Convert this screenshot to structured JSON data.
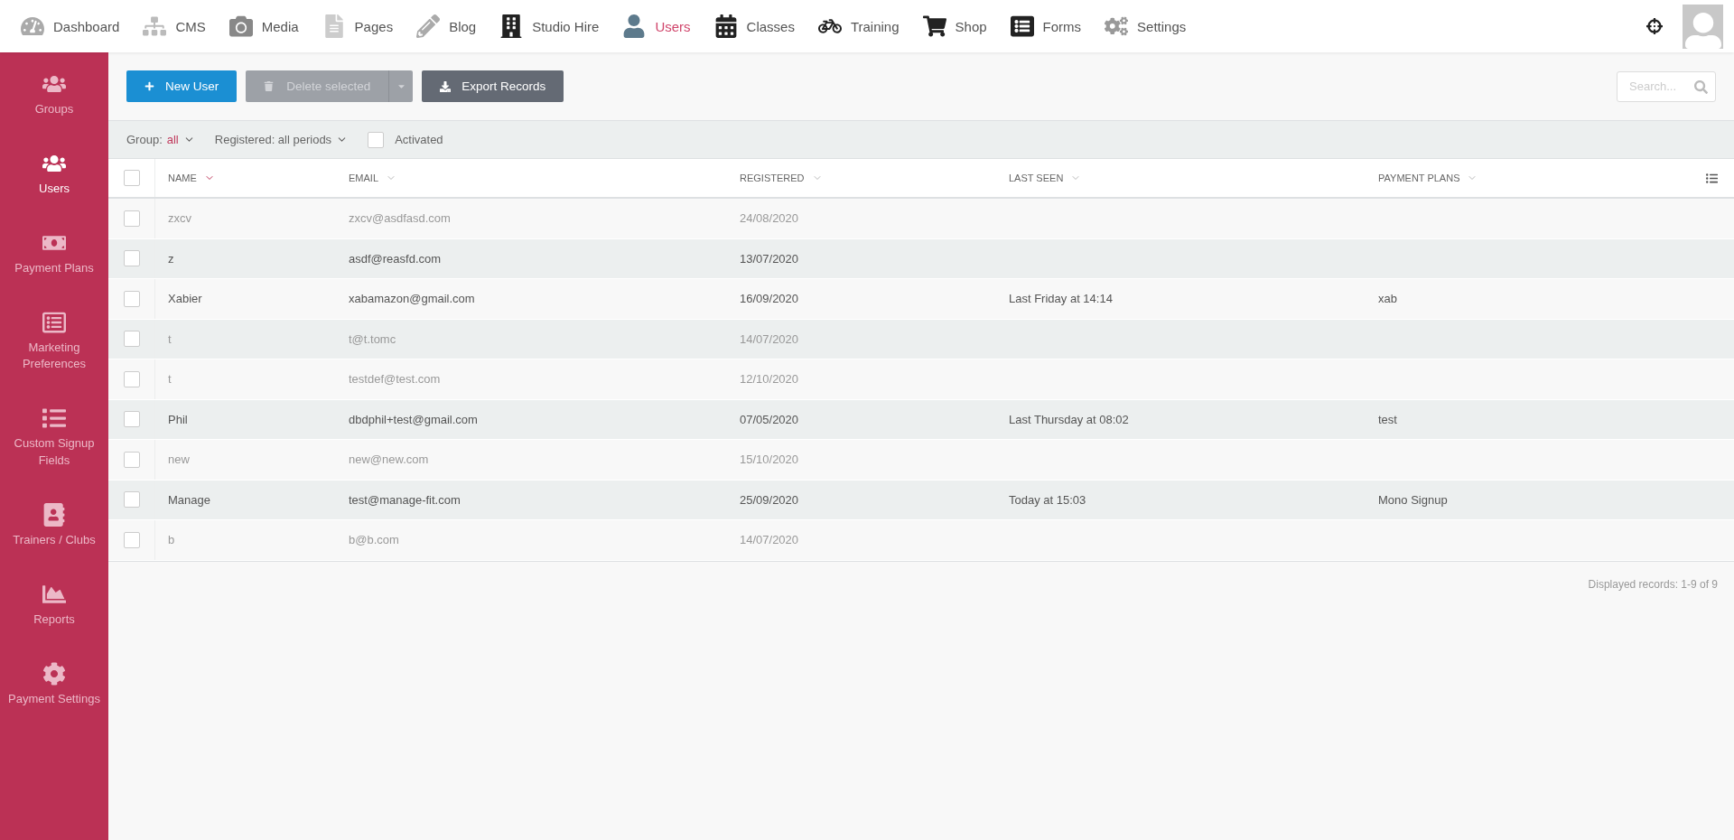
{
  "nav": {
    "items": [
      {
        "label": "Dashboard",
        "selected": false
      },
      {
        "label": "CMS",
        "selected": false
      },
      {
        "label": "Media",
        "selected": false
      },
      {
        "label": "Pages",
        "selected": false
      },
      {
        "label": "Blog",
        "selected": false
      },
      {
        "label": "Studio Hire",
        "selected": false
      },
      {
        "label": "Users",
        "selected": true
      },
      {
        "label": "Classes",
        "selected": false
      },
      {
        "label": "Training",
        "selected": false
      },
      {
        "label": "Shop",
        "selected": false
      },
      {
        "label": "Forms",
        "selected": false
      },
      {
        "label": "Settings",
        "selected": false
      }
    ]
  },
  "sidebar": {
    "items": [
      {
        "label": "Groups",
        "selected": false
      },
      {
        "label": "Users",
        "selected": true
      },
      {
        "label": "Payment Plans",
        "selected": false
      },
      {
        "label": "Marketing Preferences",
        "selected": false
      },
      {
        "label": "Custom Signup Fields",
        "selected": false
      },
      {
        "label": "Trainers / Clubs",
        "selected": false
      },
      {
        "label": "Reports",
        "selected": false
      },
      {
        "label": "Payment Settings",
        "selected": false
      }
    ]
  },
  "toolbar": {
    "new_button": "New User",
    "delete_button": {
      "label": "Delete selected",
      "disabled": true
    },
    "export_button": "Export Records",
    "search": {
      "placeholder": "Search..."
    }
  },
  "filters": {
    "group_label": "Group:",
    "group_value": "all",
    "registered": "Registered: all periods",
    "activated": {
      "label": "Activated",
      "checked": false
    }
  },
  "table": {
    "select_all": {
      "checked": false
    },
    "columns": [
      {
        "label": "NAME",
        "sorted": true
      },
      {
        "label": "EMAIL",
        "sorted": false
      },
      {
        "label": "REGISTERED",
        "sorted": false
      },
      {
        "label": "LAST SEEN",
        "sorted": false
      },
      {
        "label": "PAYMENT PLANS",
        "sorted": false
      }
    ],
    "rows": [
      {
        "checked": false,
        "activated": false,
        "cells": [
          "zxcv",
          "zxcv@asdfasd.com",
          "24/08/2020",
          "",
          ""
        ]
      },
      {
        "checked": false,
        "activated": true,
        "cells": [
          "z",
          "asdf@reasfd.com",
          "13/07/2020",
          "",
          ""
        ]
      },
      {
        "checked": false,
        "activated": true,
        "cells": [
          "Xabier",
          "xabamazon@gmail.com",
          "16/09/2020",
          "Last Friday at 14:14",
          "xab"
        ]
      },
      {
        "checked": false,
        "activated": false,
        "cells": [
          "t",
          "t@t.tomc",
          "14/07/2020",
          "",
          ""
        ]
      },
      {
        "checked": false,
        "activated": false,
        "cells": [
          "t",
          "testdef@test.com",
          "12/10/2020",
          "",
          ""
        ]
      },
      {
        "checked": false,
        "activated": true,
        "cells": [
          "Phil",
          "dbdphil+test@gmail.com",
          "07/05/2020",
          "Last Thursday at 08:02",
          "test"
        ]
      },
      {
        "checked": false,
        "activated": false,
        "cells": [
          "new",
          "new@new.com",
          "15/10/2020",
          "",
          ""
        ]
      },
      {
        "checked": false,
        "activated": true,
        "cells": [
          "Manage",
          "test@manage-fit.com",
          "25/09/2020",
          "Today at 15:03",
          "Mono Signup"
        ]
      },
      {
        "checked": false,
        "activated": false,
        "cells": [
          "b",
          "b@b.com",
          "14/07/2020",
          "",
          ""
        ]
      }
    ]
  },
  "footer": "Displayed records: 1-9 of 9"
}
